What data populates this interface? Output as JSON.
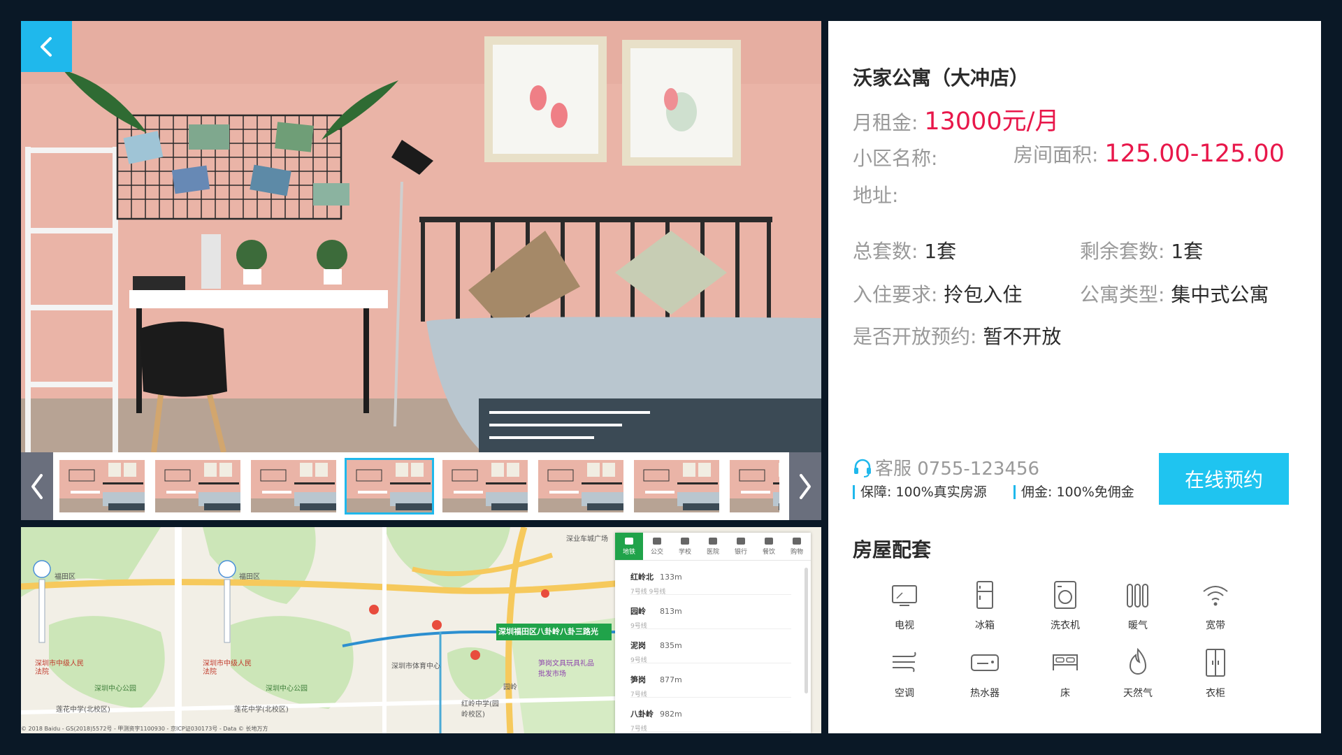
{
  "gallery": {
    "thumbnail_count": 8,
    "selected_index": 3
  },
  "map": {
    "labels": {
      "district1": "福田区",
      "district2": "福田区",
      "park1": "深圳中心公园",
      "park2": "深圳中心公园",
      "court1": "深圳市中级人民法院",
      "court2": "深圳市中级人民法院",
      "school1": "莲花中学(北校区)",
      "school2": "莲花中学(北校区)",
      "route": "深圳福田区八卦岭八卦三路光",
      "stadium": "深圳市体育中心",
      "market": "笋岗文具玩具礼品批发市场",
      "yuanling": "园岭",
      "hongling": "红岭中学(园岭校区)",
      "square": "深业车城广场"
    },
    "tabs": [
      "地铁",
      "公交",
      "学校",
      "医院",
      "银行",
      "餐饮",
      "购物"
    ],
    "active_tab": 0,
    "stations": [
      {
        "name": "红岭北",
        "distance": "133m",
        "line": "7号线 9号线"
      },
      {
        "name": "园岭",
        "distance": "813m",
        "line": "9号线"
      },
      {
        "name": "泥岗",
        "distance": "835m",
        "line": "9号线"
      },
      {
        "name": "笋岗",
        "distance": "877m",
        "line": "7号线"
      },
      {
        "name": "八卦岭",
        "distance": "982m",
        "line": "7号线"
      }
    ],
    "copyright": "© 2018 Baidu - GS(2018)5572号 - 甲测资字1100930 - 京ICP证030173号 - Data © 长地万方"
  },
  "listing": {
    "title": "沃家公寓（大冲店）",
    "rent_label": "月租金:",
    "rent_value": "13000元/月",
    "community_label": "小区名称:",
    "area_label": "房间面积:",
    "area_value": "125.00-125.00",
    "address_label": "地址:",
    "total_label": "总套数:",
    "total_value": "1套",
    "remaining_label": "剩余套数:",
    "remaining_value": "1套",
    "checkin_label": "入住要求:",
    "checkin_value": "拎包入住",
    "type_label": "公寓类型:",
    "type_value": "集中式公寓",
    "booking_label": "是否开放预约:",
    "booking_value": "暂不开放"
  },
  "service": {
    "label": "客服 0755-123456",
    "guarantee": "保障: 100%真实房源",
    "commission": "佣金: 100%免佣金",
    "book_button": "在线预约"
  },
  "amenities": {
    "title": "房屋配套",
    "items": [
      {
        "label": "电视",
        "icon": "tv-icon"
      },
      {
        "label": "冰箱",
        "icon": "fridge-icon"
      },
      {
        "label": "洗衣机",
        "icon": "washer-icon"
      },
      {
        "label": "暖气",
        "icon": "heater-icon"
      },
      {
        "label": "宽带",
        "icon": "wifi-icon"
      },
      {
        "label": "空调",
        "icon": "ac-icon"
      },
      {
        "label": "热水器",
        "icon": "water-heater-icon"
      },
      {
        "label": "床",
        "icon": "bed-icon"
      },
      {
        "label": "天然气",
        "icon": "gas-icon"
      },
      {
        "label": "衣柜",
        "icon": "wardrobe-icon"
      }
    ]
  },
  "colors": {
    "accent": "#1fb8ec",
    "price": "#e8174a",
    "background": "#0a1826"
  }
}
